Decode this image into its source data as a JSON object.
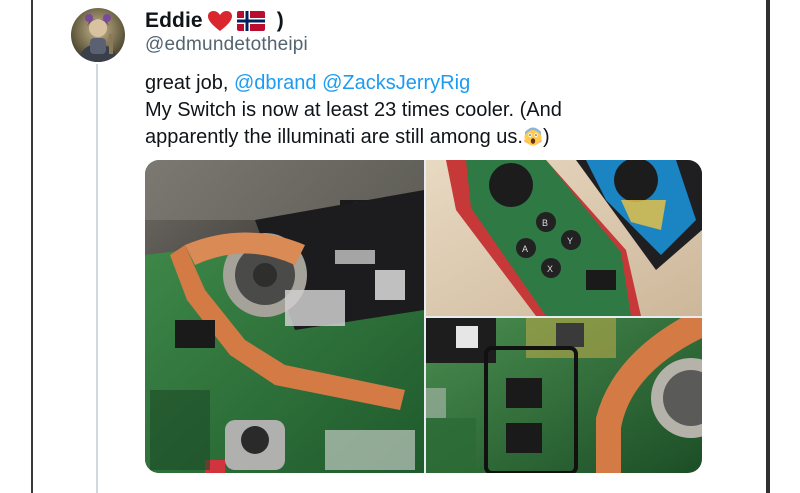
{
  "tweet": {
    "author": {
      "display_name": "Eddie",
      "name_emoji": [
        "heart-icon",
        "norway-flag-icon"
      ],
      "name_suffix": ")",
      "handle": "@edmundetotheipi"
    },
    "text": {
      "line1_prefix": "great job, ",
      "mentions": [
        "@dbrand",
        "@ZacksJerryRig"
      ],
      "line2": "My Switch is now at least 23 times cooler. (And",
      "line3_prefix": "apparently the illuminati are still among us.",
      "line3_emoji": "screaming-face-icon",
      "line3_suffix": ")"
    },
    "media": {
      "count": 3,
      "photos": [
        {
          "subject": "transparent switch console interior with copper heat pipe and fan"
        },
        {
          "subject": "transparent joy-con with face buttons"
        },
        {
          "subject": "circuit board with copper heat pipe"
        }
      ]
    }
  },
  "colors": {
    "text_primary": "#0f1419",
    "text_secondary": "#536471",
    "mention": "#1d9bf0",
    "thread_line": "#cfd9de"
  }
}
